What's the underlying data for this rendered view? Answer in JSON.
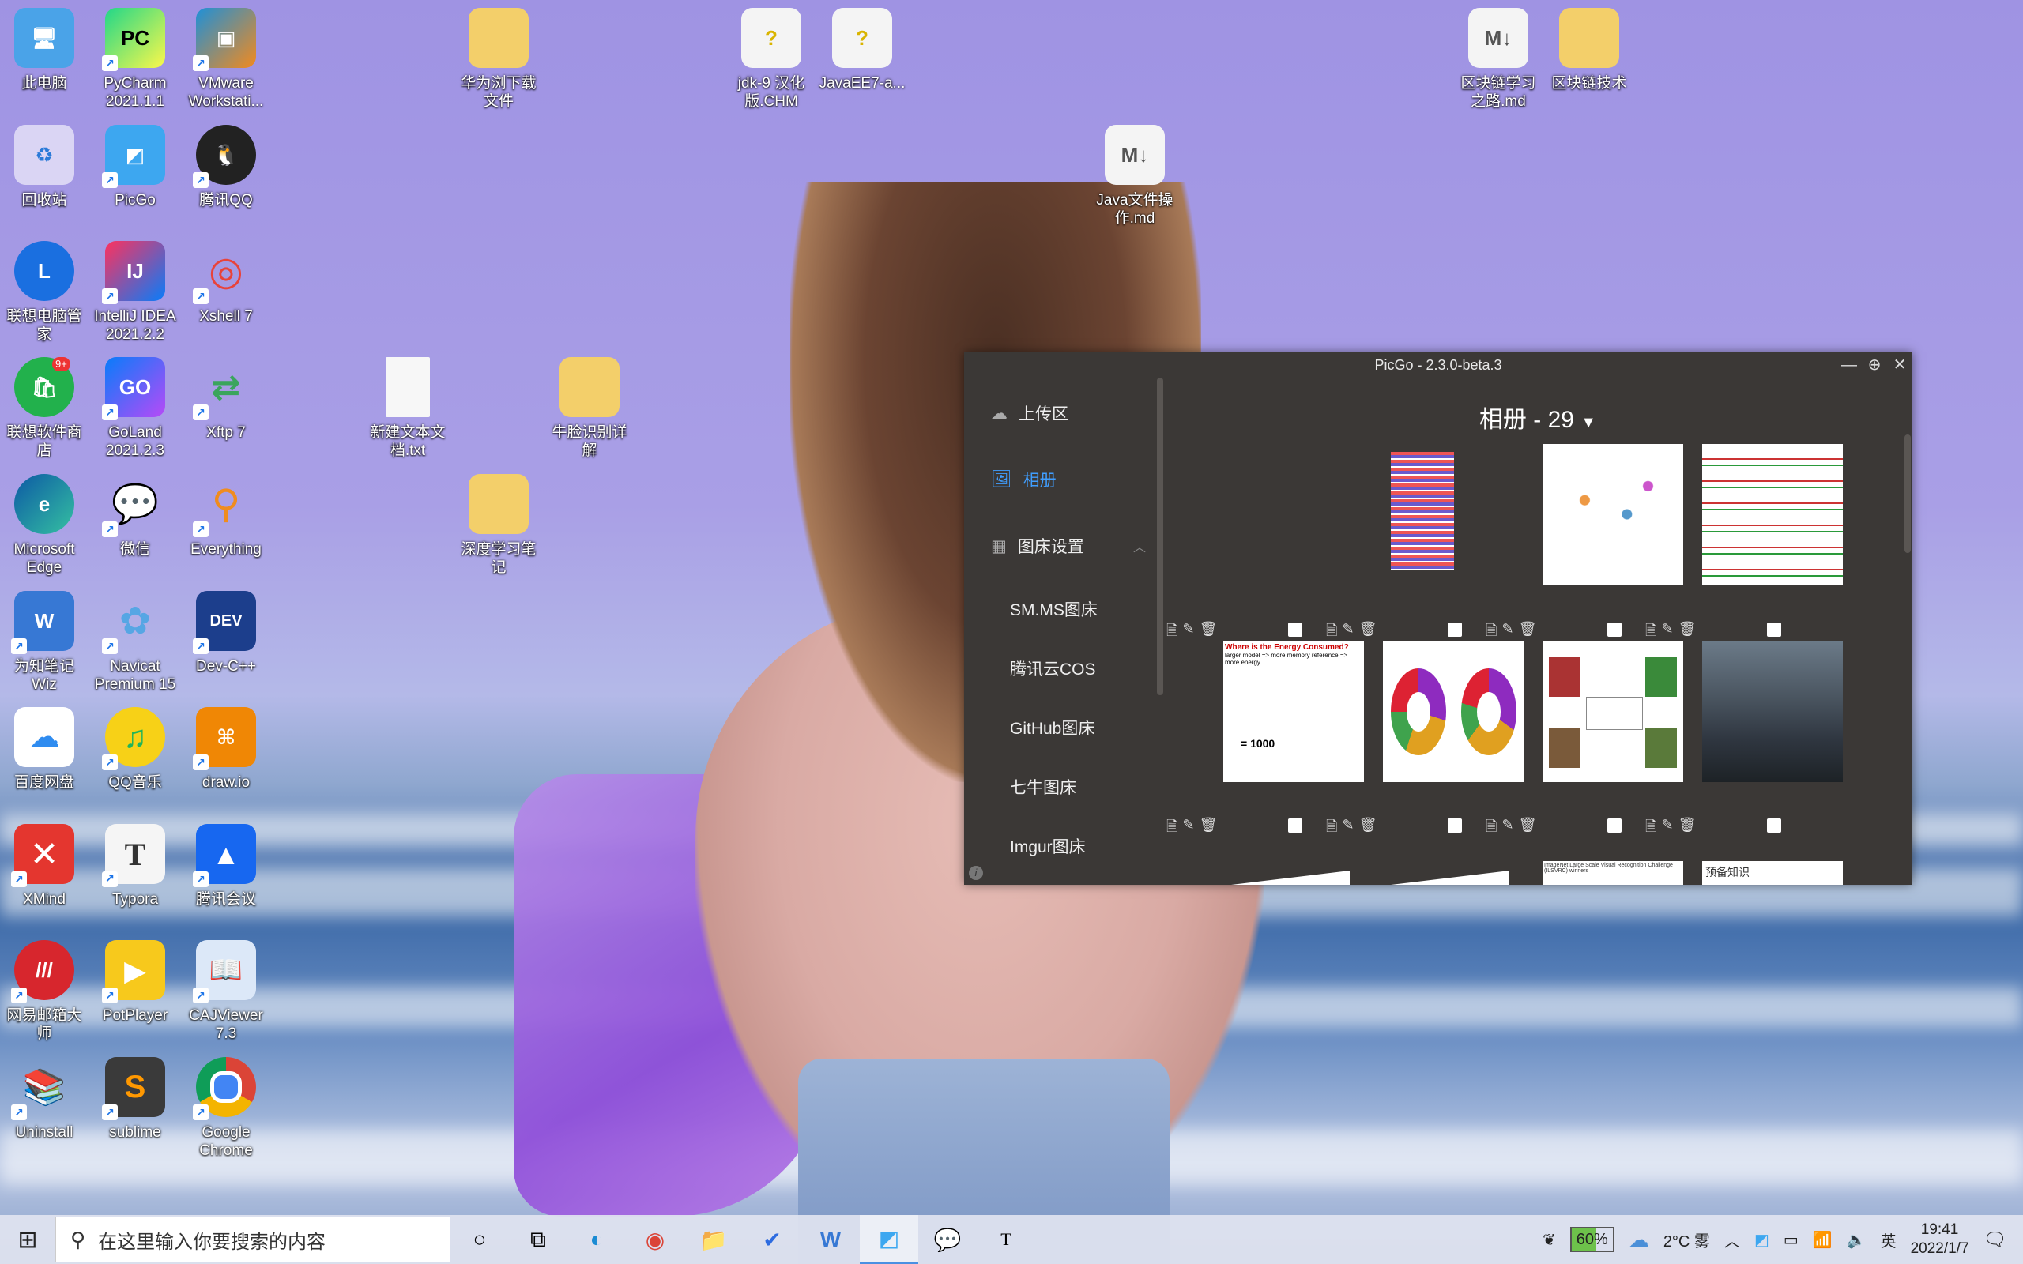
{
  "desktop": {
    "icons": [
      {
        "label": "此电脑",
        "name": "this-pc-icon"
      },
      {
        "label": "PyCharm 2021.1.1",
        "name": "pycharm-icon"
      },
      {
        "label": "VMware Workstati...",
        "name": "vmware-icon"
      },
      {
        "label": "华为浏下载文件",
        "name": "folder-icon"
      },
      {
        "label": "jdk-9 汉化版.CHM",
        "name": "chm-file-icon"
      },
      {
        "label": "JavaEE7-a...",
        "name": "chm-file-icon"
      },
      {
        "label": "区块链学习之路.md",
        "name": "markdown-file-icon"
      },
      {
        "label": "区块链技术",
        "name": "folder-icon"
      },
      {
        "label": "回收站",
        "name": "recycle-bin-icon"
      },
      {
        "label": "PicGo",
        "name": "picgo-icon"
      },
      {
        "label": "腾讯QQ",
        "name": "qq-icon"
      },
      {
        "label": "Java文件操作.md",
        "name": "markdown-file-icon"
      },
      {
        "label": "联想电脑管家",
        "name": "lenovo-manager-icon"
      },
      {
        "label": "IntelliJ IDEA 2021.2.2",
        "name": "intellij-icon"
      },
      {
        "label": "Xshell 7",
        "name": "xshell-icon"
      },
      {
        "label": "联想软件商店",
        "name": "lenovo-store-icon"
      },
      {
        "label": "GoLand 2021.2.3",
        "name": "goland-icon"
      },
      {
        "label": "Xftp 7",
        "name": "xftp-icon"
      },
      {
        "label": "新建文本文档.txt",
        "name": "text-file-icon"
      },
      {
        "label": "牛脸识别详解",
        "name": "folder-icon"
      },
      {
        "label": "Microsoft Edge",
        "name": "edge-icon"
      },
      {
        "label": "微信",
        "name": "wechat-icon"
      },
      {
        "label": "Everything",
        "name": "everything-icon"
      },
      {
        "label": "深度学习笔记",
        "name": "folder-icon"
      },
      {
        "label": "为知笔记 Wiz",
        "name": "wiz-icon"
      },
      {
        "label": "Navicat Premium 15",
        "name": "navicat-icon"
      },
      {
        "label": "Dev-C++",
        "name": "devcpp-icon"
      },
      {
        "label": "百度网盘",
        "name": "baidu-netdisk-icon"
      },
      {
        "label": "QQ音乐",
        "name": "qqmusic-icon"
      },
      {
        "label": "draw.io",
        "name": "drawio-icon"
      },
      {
        "label": "XMind",
        "name": "xmind-icon"
      },
      {
        "label": "Typora",
        "name": "typora-icon"
      },
      {
        "label": "腾讯会议",
        "name": "tencent-meeting-icon"
      },
      {
        "label": "网易邮箱大师",
        "name": "netease-mail-icon"
      },
      {
        "label": "PotPlayer",
        "name": "potplayer-icon"
      },
      {
        "label": "CAJViewer 7.3",
        "name": "cajviewer-icon"
      },
      {
        "label": "Uninstall",
        "name": "uninstall-icon"
      },
      {
        "label": "sublime",
        "name": "sublime-icon"
      },
      {
        "label": "Google Chrome",
        "name": "chrome-icon"
      }
    ],
    "badge": "9+"
  },
  "picgo": {
    "title": "PicGo - 2.3.0-beta.3",
    "window_buttons": {
      "minimize": "—",
      "maximize": "⊕",
      "close": "✕"
    },
    "sidebar": {
      "upload": "上传区",
      "album": "相册",
      "settings": "图床设置",
      "subitems": [
        "SM.MS图床",
        "腾讯云COS",
        "GitHub图床",
        "七牛图床",
        "Imgur图床"
      ]
    },
    "album_title": "相册 - 29",
    "thumbs_partial_text": [
      "ImageNet Large Scale Visual Recognition Challenge (ILSVRC) winners",
      "预备知识"
    ],
    "thumb2_label": "Where is the Energy Consumed?",
    "thumb2_sub": "larger model => more memory reference => more energy",
    "thumb2_value": "= 1000"
  },
  "taskbar": {
    "search_placeholder": "在这里输入你要搜索的内容",
    "battery": "60%",
    "weather": "2°C 雾",
    "ime": "英",
    "time": "19:41",
    "date": "2022/1/7"
  },
  "colors": {
    "accent": "#409eff",
    "window_bg": "#3b3836"
  }
}
